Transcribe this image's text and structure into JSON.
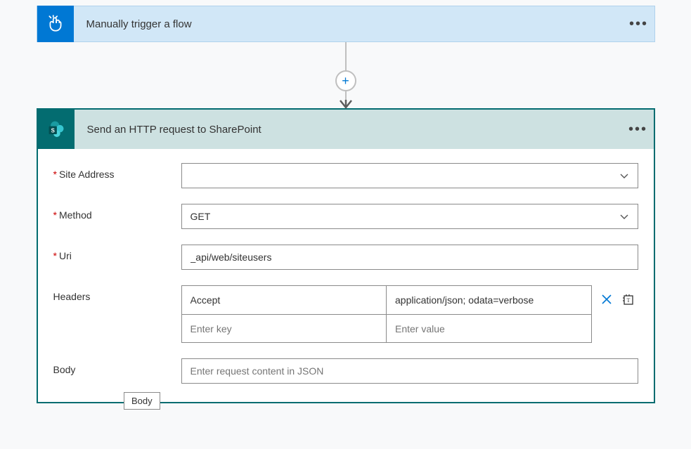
{
  "trigger": {
    "title": "Manually trigger a flow"
  },
  "action": {
    "title": "Send an HTTP request to SharePoint",
    "fields": {
      "site_address": {
        "label": "Site Address",
        "value": ""
      },
      "method": {
        "label": "Method",
        "value": "GET"
      },
      "uri": {
        "label": "Uri",
        "value": "_api/web/siteusers"
      },
      "headers": {
        "label": "Headers",
        "rows": [
          {
            "key": "Accept",
            "value": "application/json; odata=verbose"
          },
          {
            "key": "",
            "value": ""
          }
        ],
        "key_placeholder": "Enter key",
        "value_placeholder": "Enter value"
      },
      "body": {
        "label": "Body",
        "placeholder": "Enter request content in JSON",
        "value": ""
      }
    }
  },
  "tooltip": {
    "body": "Body"
  }
}
